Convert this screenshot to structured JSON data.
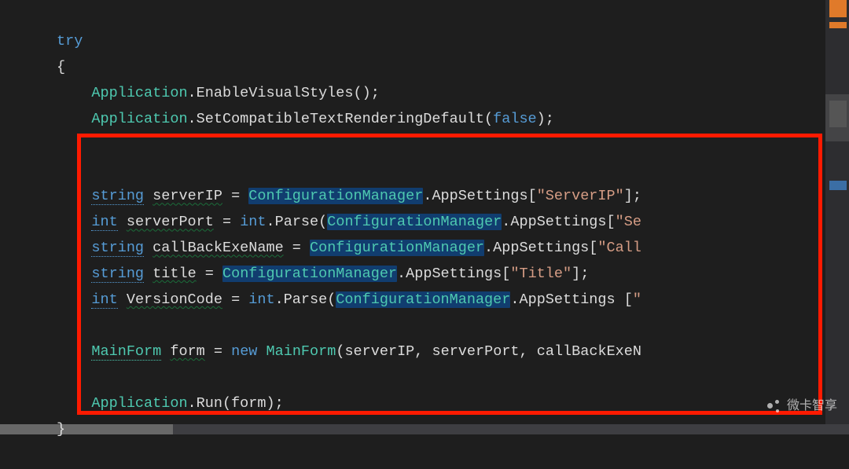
{
  "code": {
    "try": "try",
    "openBrace": "{",
    "app": "Application",
    "dot": ".",
    "enableVisualStyles": "EnableVisualStyles",
    "parenEmpty": "()",
    "semi": ";",
    "setCompat": "SetCompatibleTextRenderingDefault",
    "openParen": "(",
    "closeParen": ")",
    "falseKw": "false",
    "stringKw": "string",
    "intKw": "int",
    "newKw": "new",
    "serverIPVar": "serverIP",
    "serverPortVar": "serverPort",
    "callBackVar": "callBackExeName",
    "titleVar": "title",
    "versionCodeVar": "VersionCode",
    "eq": " = ",
    "cfgMgr": "ConfigurationManager",
    "appSettings": "AppSettings",
    "parse": "Parse",
    "idxOpen": "[",
    "idxClose": "]",
    "strServerIP": "\"ServerIP\"",
    "strSePartial": "\"Se",
    "strCall": "\"Call",
    "strTitle": "\"Title\"",
    "strPartialOpen": "\"",
    "mainFormType": "MainForm",
    "formVar": "form",
    "comma": ", ",
    "callBackExeN": "callBackExeN",
    "run": "Run",
    "closeBrace": "}"
  },
  "watermark": "微卡智享"
}
